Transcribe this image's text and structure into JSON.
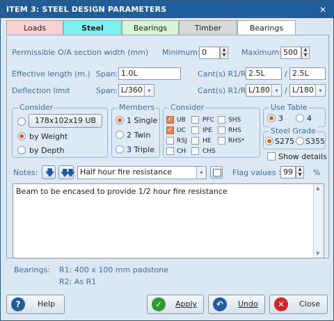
{
  "window": {
    "title": "ITEM 3: STEEL DESIGN PARAMETERS",
    "close": "✕"
  },
  "tabs": [
    {
      "label": "Loads",
      "color": "#fad0d0"
    },
    {
      "label": "Steel",
      "color": "#7ff0f0",
      "active": true
    },
    {
      "label": "Bearings",
      "color": "#d6f5d6"
    },
    {
      "label": "Timber",
      "color": "#d9d9d9"
    },
    {
      "label": "Bearings",
      "color": "#ffffff"
    }
  ],
  "section_width": {
    "label": "Permissible O/A section width (mm)",
    "min_label": "Minimum:",
    "min_value": "0",
    "max_label": "Maximum:",
    "max_value": "500"
  },
  "effective_length": {
    "label": "Effective length (m.)",
    "span_label": "Span:",
    "span_value": "1.0L",
    "cant_label": "Cant(s) R1/R2:",
    "cant1": "2.5L",
    "sep": "/",
    "cant2": "2.5L"
  },
  "deflection": {
    "label": "Deflection limit",
    "span_label": "Span:",
    "span_value": "L/360",
    "cant_label": "Cant(s) R1/R2:",
    "cant1": "L/180",
    "sep": "/",
    "cant2": "L/180"
  },
  "consider_group": {
    "title": "Consider",
    "section_button": "178x102x19 UB",
    "opt_weight": "by Weight",
    "opt_depth": "by Depth"
  },
  "members_group": {
    "title": "Members",
    "single": "1 Single",
    "twin": "2 Twin",
    "triple": "3 Triple"
  },
  "types_group": {
    "title": "Consider",
    "items": [
      {
        "label": "UB",
        "checked": true
      },
      {
        "label": "PFC",
        "checked": false
      },
      {
        "label": "SHS",
        "checked": false
      },
      {
        "label": "UC",
        "checked": true
      },
      {
        "label": "IPE",
        "checked": false
      },
      {
        "label": "RHS",
        "checked": false
      },
      {
        "label": "RSJ",
        "checked": false
      },
      {
        "label": "HE",
        "checked": false
      },
      {
        "label": "RHS*",
        "checked": false
      },
      {
        "label": "CH",
        "checked": false
      },
      {
        "label": "CHS",
        "checked": false
      }
    ]
  },
  "use_table": {
    "title": "Use Table",
    "opt3": "3",
    "opt4": "4"
  },
  "steel_grade": {
    "title": "Steel Grade",
    "s275": "S275",
    "s355": "S355"
  },
  "show_details": "Show details",
  "notes": {
    "label": "Notes:",
    "select_value": "Half hour fire resistance",
    "flag_label": "Flag values >",
    "flag_value": "99",
    "flag_unit": "%",
    "text": "Beam to be encased to provide 1/2 hour fire resistance"
  },
  "bearings_info": {
    "label": "Bearings:",
    "r1": "R1: 400 x 100 mm padstone",
    "r2": "R2: As R1"
  },
  "buttons": {
    "help": "Help",
    "apply": "Apply",
    "undo": "Undo",
    "close": "Close"
  },
  "colors": {
    "accent_orange": "#e05a1e",
    "titlebar": "#1f5d9b",
    "label_blue": "#3b6fa3"
  }
}
